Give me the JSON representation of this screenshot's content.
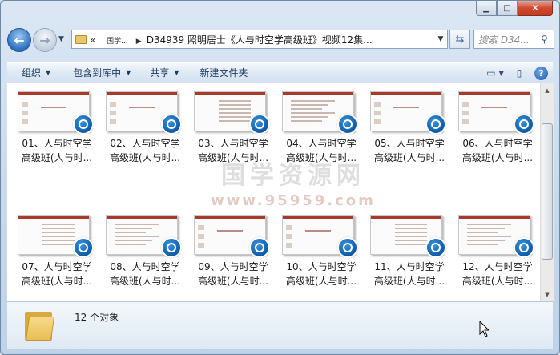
{
  "window": {
    "caption": {
      "minimize": "▁",
      "maximize": "□",
      "close": "✕"
    }
  },
  "nav": {
    "back_glyph": "←",
    "forward_glyph": "→",
    "dropdown_glyph": "▼"
  },
  "address": {
    "overflow": "«",
    "crumbs": [
      "国学...",
      "D34939 照明居士《人与时空学高级班》视频12集..."
    ],
    "separator": "▶",
    "dropdown_glyph": "▼"
  },
  "search": {
    "placeholder": "搜索 D34...",
    "icon": "search-icon"
  },
  "toolbar": {
    "organize": "组织",
    "include_in_library": "包含到库中",
    "share": "共享",
    "new_folder": "新建文件夹",
    "dropdown_glyph": "▼"
  },
  "files": [
    {
      "line1": "01、人与时空学",
      "line2": "高级班(人与时..."
    },
    {
      "line1": "02、人与时空学",
      "line2": "高级班(人与时..."
    },
    {
      "line1": "03、人与时空学",
      "line2": "高级班(人与时..."
    },
    {
      "line1": "04、人与时空学",
      "line2": "高级班(人与时..."
    },
    {
      "line1": "05、人与时空学",
      "line2": "高级班(人与时..."
    },
    {
      "line1": "06、人与时空学",
      "line2": "高级班(人与时..."
    },
    {
      "line1": "07、人与时空学",
      "line2": "高级班(人与时..."
    },
    {
      "line1": "08、人与时空学",
      "line2": "高级班(人与时..."
    },
    {
      "line1": "09、人与时空学",
      "line2": "高级班(人与时..."
    },
    {
      "line1": "10、人与时空学",
      "line2": "高级班(人与时..."
    },
    {
      "line1": "11、人与时空学",
      "line2": "高级班(人与时..."
    },
    {
      "line1": "12、人与时空学",
      "line2": "高级班(人与时..."
    }
  ],
  "watermark": {
    "text": "国学资源网",
    "url": "www.95959.com"
  },
  "status": {
    "count": "12 个对象"
  },
  "colors": {
    "accent": "#1f5aa4",
    "slide_bar": "#a93a2b",
    "badge": "#0d5aa8"
  }
}
